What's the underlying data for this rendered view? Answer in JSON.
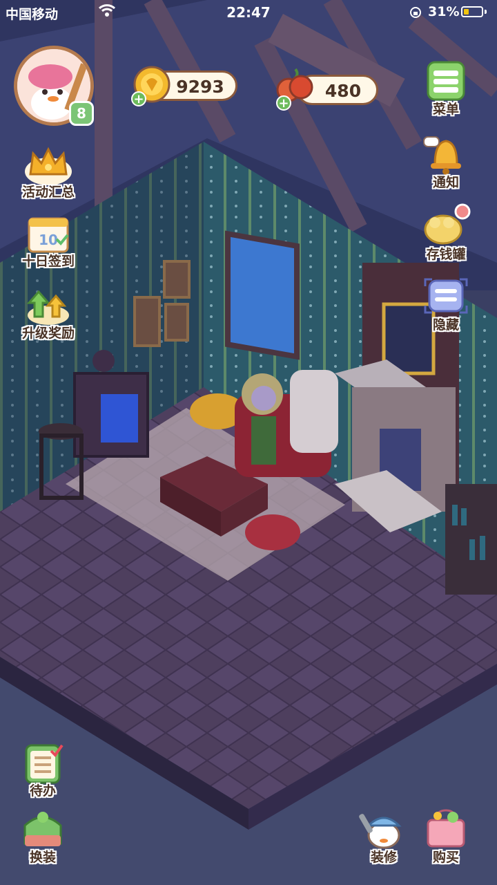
{
  "status_bar": {
    "carrier": "中国移动",
    "time": "22:47",
    "battery_text": "31%",
    "battery_level": 0.31
  },
  "player": {
    "level": "8"
  },
  "currency": {
    "coins": "9293",
    "fruit": "480"
  },
  "left_menu": [
    {
      "label": "活动汇总",
      "icon": "crown-icon"
    },
    {
      "label": "十日签到",
      "icon": "calendar-icon"
    },
    {
      "label": "升级奖励",
      "icon": "level-up-icon"
    }
  ],
  "right_menu": [
    {
      "label": "菜单",
      "icon": "menu-icon"
    },
    {
      "label": "通知",
      "icon": "bell-icon"
    },
    {
      "label": "存钱罐",
      "icon": "piggy-bank-icon"
    },
    {
      "label": "隐藏",
      "icon": "hide-icon"
    }
  ],
  "bottom_left": [
    {
      "label": "待办",
      "icon": "todo-list-icon"
    },
    {
      "label": "换装",
      "icon": "wardrobe-icon"
    }
  ],
  "bottom_right": [
    {
      "label": "装修",
      "icon": "decorate-icon"
    },
    {
      "label": "购买",
      "icon": "shop-icon"
    }
  ]
}
